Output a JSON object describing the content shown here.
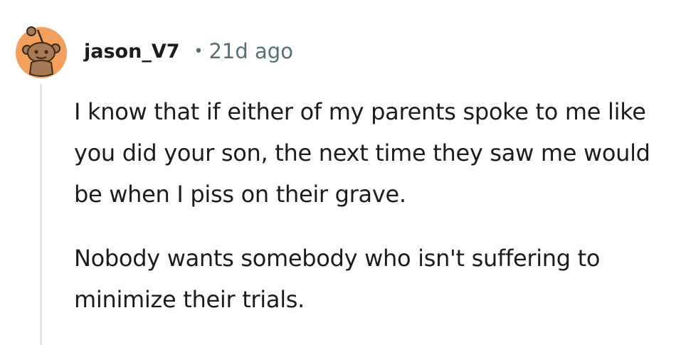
{
  "comment": {
    "author": "jason_V7",
    "separator": "•",
    "timestamp": "21d ago",
    "avatar_icon": "snoo-avatar-icon",
    "avatar_color": "#f2a05b",
    "paragraphs": [
      "I know that if either of my parents spoke to me like you did your son, the next time they saw me would be when I piss on their grave.",
      "Nobody wants somebody who isn't suffering to minimize their trials."
    ]
  }
}
